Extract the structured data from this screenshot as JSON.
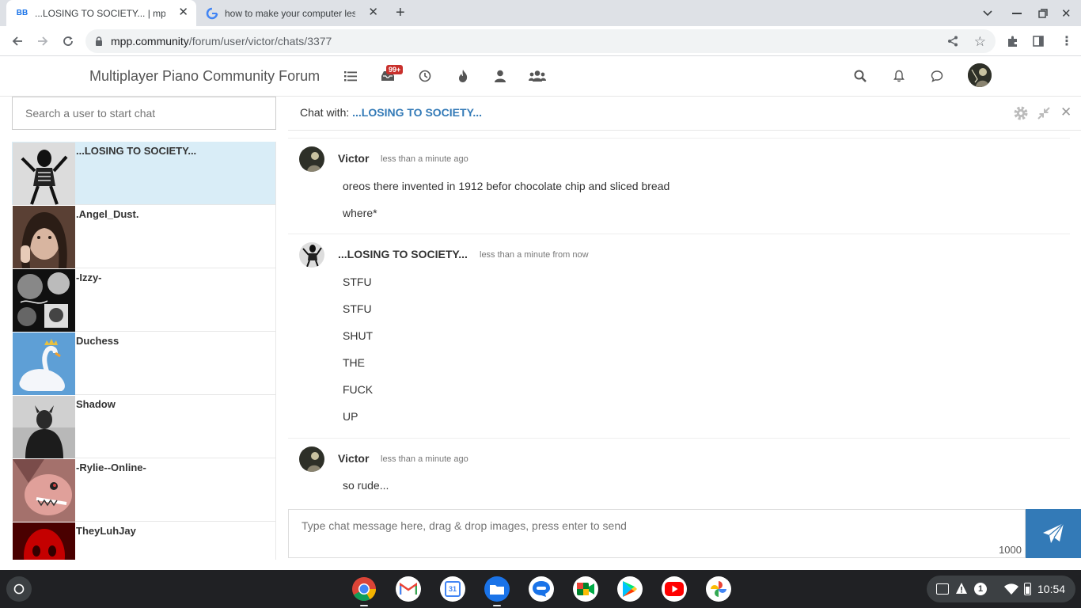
{
  "browser": {
    "tabs": [
      {
        "title": "...LOSING TO SOCIETY... | mpp.co",
        "active": true,
        "favicon": "nodebb-icon"
      },
      {
        "title": "how to make your computer less",
        "active": false,
        "favicon": "google-icon"
      }
    ],
    "url": {
      "host": "mpp.community",
      "path": "/forum/user/victor/chats/3377"
    }
  },
  "forum": {
    "brand": "Multiplayer Piano Community Forum",
    "notification_badge": "99+",
    "nav_icons": [
      "categories-icon",
      "unread-icon",
      "recent-icon",
      "popular-icon",
      "users-icon",
      "groups-icon"
    ],
    "right_icons": [
      "search-icon",
      "bell-icon",
      "chat-bubble-icon",
      "user-avatar"
    ]
  },
  "sidebar": {
    "search_placeholder": "Search a user to start chat",
    "users": [
      {
        "name": "...LOSING TO SOCIETY...",
        "active": true,
        "avatar_color": "#555555"
      },
      {
        "name": ".Angel_Dust.",
        "active": false,
        "avatar_color": "#6b4a3a"
      },
      {
        "name": "-Izzy-",
        "active": false,
        "avatar_color": "#1a1a1a"
      },
      {
        "name": "Duchess",
        "active": false,
        "avatar_color": "#4a90c8"
      },
      {
        "name": "Shadow",
        "active": false,
        "avatar_color": "#9a9a9a"
      },
      {
        "name": "-Rylie--Online-",
        "active": false,
        "avatar_color": "#c98a86"
      },
      {
        "name": "TheyLuhJay",
        "active": false,
        "avatar_color": "#b30000"
      }
    ]
  },
  "chat": {
    "with_label": "Chat with:",
    "with_name": "...LOSING TO SOCIETY...",
    "messages": [
      {
        "author": "Victor",
        "time": "less than a minute ago",
        "lines": [
          "oreos there invented in 1912 befor chocolate chip and sliced bread",
          "where*"
        ]
      },
      {
        "author": "...LOSING TO SOCIETY...",
        "time": "less than a minute from now",
        "lines": [
          "STFU",
          "STFU",
          "SHUT",
          "THE",
          "FUCK",
          "UP"
        ]
      },
      {
        "author": "Victor",
        "time": "less than a minute ago",
        "lines": [
          "so rude..."
        ]
      }
    ],
    "composer_placeholder": "Type chat message here, drag & drop images, press enter to send",
    "char_count": "1000"
  },
  "shelf": {
    "apps": [
      "chrome-icon",
      "gmail-icon",
      "calendar-icon",
      "files-icon",
      "messages-icon",
      "meet-icon",
      "play-store-icon",
      "youtube-icon",
      "photos-icon"
    ],
    "calendar_day": "31",
    "tray_badge": "1",
    "clock": "10:54"
  }
}
